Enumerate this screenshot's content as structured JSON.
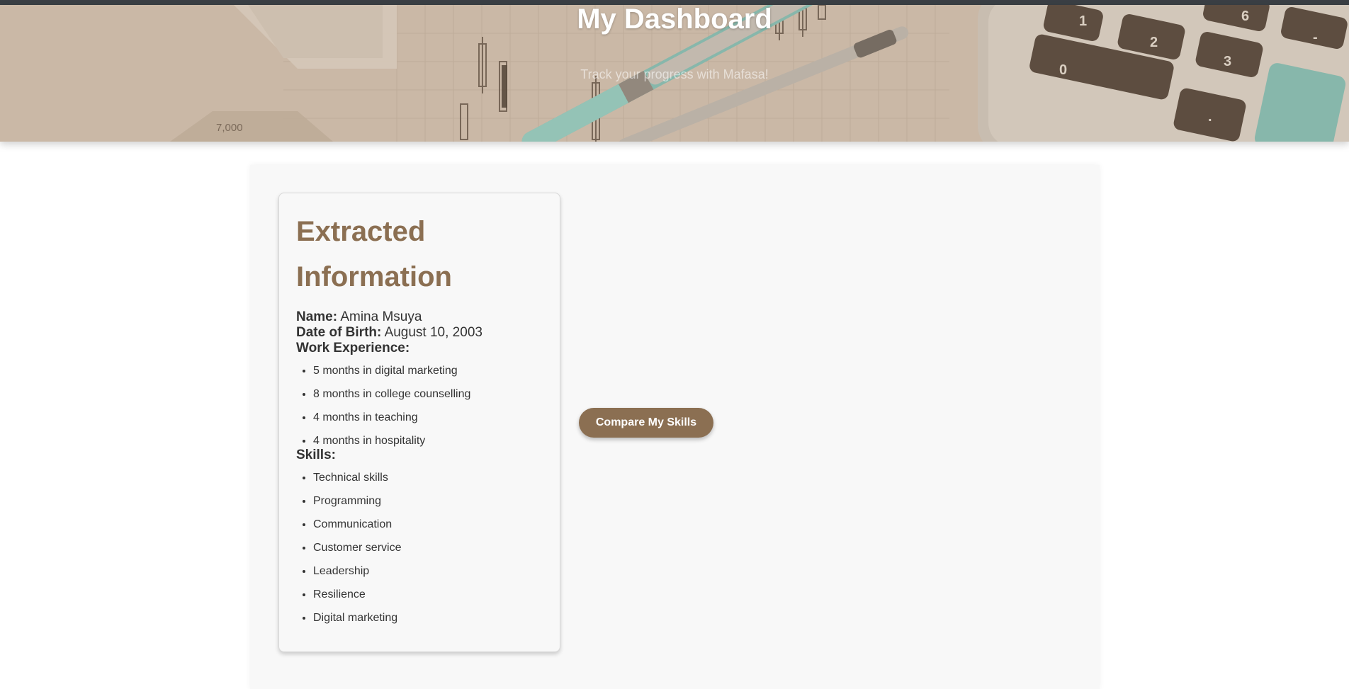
{
  "header": {
    "title": "My Dashboard",
    "subtitle": "Track your progress with Mafasa!"
  },
  "card": {
    "title": "Extracted Information",
    "name_label": "Name:",
    "name_value": "Amina Msuya",
    "dob_label": "Date of Birth:",
    "dob_value": "August 10, 2003",
    "work_label": "Work Experience:",
    "work_experience": [
      "5 months in digital marketing",
      "8 months in college counselling",
      "4 months in teaching",
      "4 months in hospitality"
    ],
    "skills_label": "Skills:",
    "skills": [
      "Technical skills",
      "Programming",
      "Communication",
      "Customer service",
      "Leadership",
      "Resilience",
      "Digital marketing"
    ]
  },
  "actions": {
    "compare_label": "Compare My Skills"
  },
  "hero_image": {
    "chart_tick_label": "7,000",
    "keys": [
      "0",
      "1",
      "2",
      "3",
      "6",
      "-",
      "."
    ]
  },
  "colors": {
    "accent": "#8b6f52",
    "hero_tint": "#c9b8a6",
    "panel_bg": "#f8f8f8",
    "text": "#333333"
  }
}
